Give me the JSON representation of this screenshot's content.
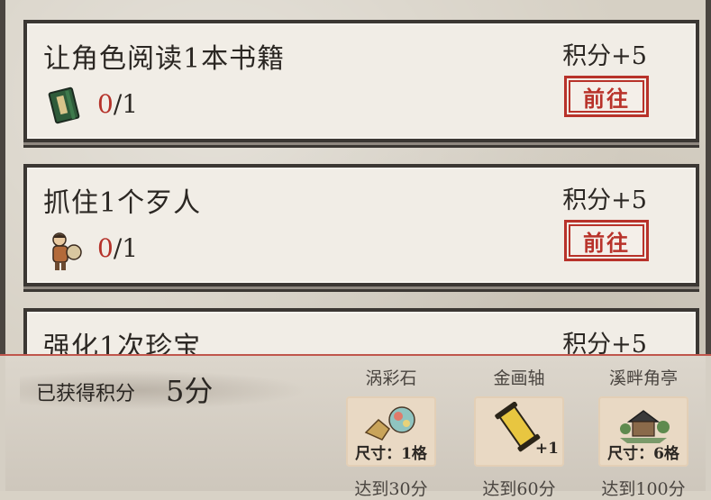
{
  "tasks": [
    {
      "title": "让角色阅读1本书籍",
      "points": "积分+5",
      "progress_current": "0",
      "progress_total": "/1",
      "button": "前往",
      "icon": "book-icon"
    },
    {
      "title": "抓住1个歹人",
      "points": "积分+5",
      "progress_current": "0",
      "progress_total": "/1",
      "button": "前往",
      "icon": "bandit-character-icon"
    },
    {
      "title": "强化1次珍宝",
      "points": "积分+5"
    }
  ],
  "summary": {
    "label": "已获得积分",
    "value": "5分"
  },
  "rewards": [
    {
      "name": "涡彩石",
      "size_text": "尺寸：1格",
      "requirement": "达到30分",
      "icon": "colorful-stone-icon"
    },
    {
      "name": "金画轴",
      "qty_text": "+1",
      "requirement": "达到60分",
      "icon": "golden-scroll-icon"
    },
    {
      "name": "溪畔角亭",
      "size_text": "尺寸：6格",
      "requirement": "达到100分",
      "icon": "pavilion-icon"
    }
  ],
  "colors": {
    "accent_red": "#b8322a",
    "card_bg": "#f1ede6",
    "border": "#3b3733"
  }
}
